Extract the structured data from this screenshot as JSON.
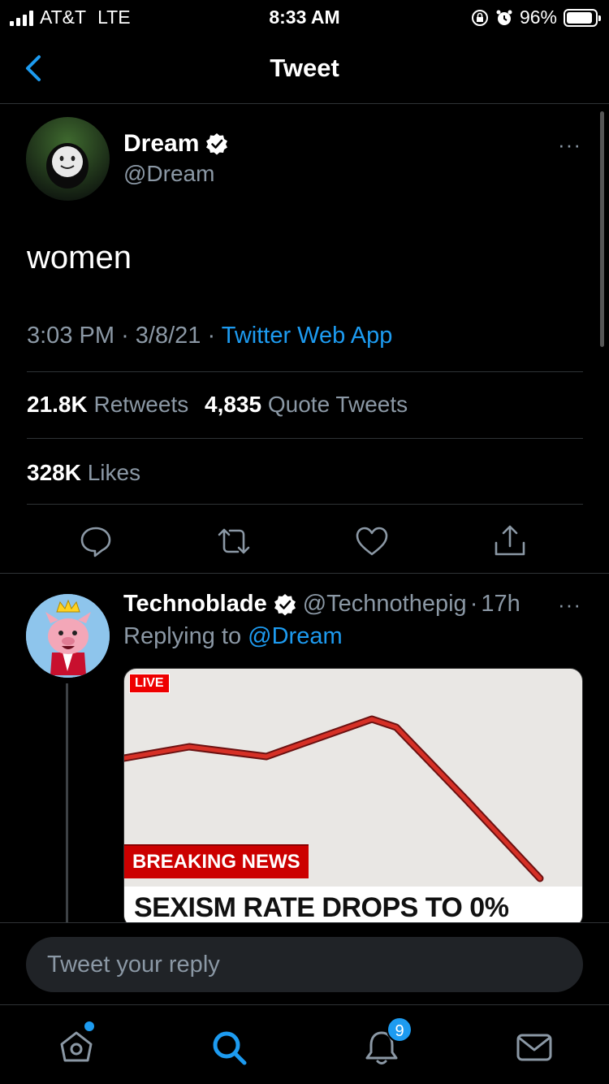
{
  "status": {
    "carrier": "AT&T",
    "network": "LTE",
    "time": "8:33 AM",
    "battery": "96%"
  },
  "nav": {
    "title": "Tweet"
  },
  "tweet": {
    "name": "Dream",
    "handle": "@Dream",
    "text": "women",
    "time": "3:03 PM",
    "sep1": "·",
    "date": "3/8/21",
    "sep2": "·",
    "app": "Twitter Web App",
    "retweets": "21.8K",
    "retweets_label": "Retweets",
    "quotes": "4,835",
    "quotes_label": "Quote Tweets",
    "likes": "328K",
    "likes_label": "Likes",
    "more": "···"
  },
  "reply": {
    "name": "Technoblade",
    "handle": "@Technothepig",
    "sep": "·",
    "age": "17h",
    "replying_prefix": "Replying to",
    "replying_to": "@Dream",
    "more": "···",
    "media": {
      "live": "LIVE",
      "banner": "BREAKING NEWS",
      "headline": "SEXISM RATE DROPS TO 0%"
    }
  },
  "composer": {
    "placeholder": "Tweet your reply"
  },
  "tabbar": {
    "notifications_badge": "9"
  },
  "colors": {
    "accent": "#1d9bf0",
    "background": "#000000",
    "secondary": "#8b98a5"
  },
  "icons": [
    "back-chevron-icon",
    "verified-badge-icon",
    "reply-icon",
    "retweet-icon",
    "like-icon",
    "share-icon",
    "home-icon",
    "search-icon",
    "notifications-icon",
    "messages-icon"
  ]
}
